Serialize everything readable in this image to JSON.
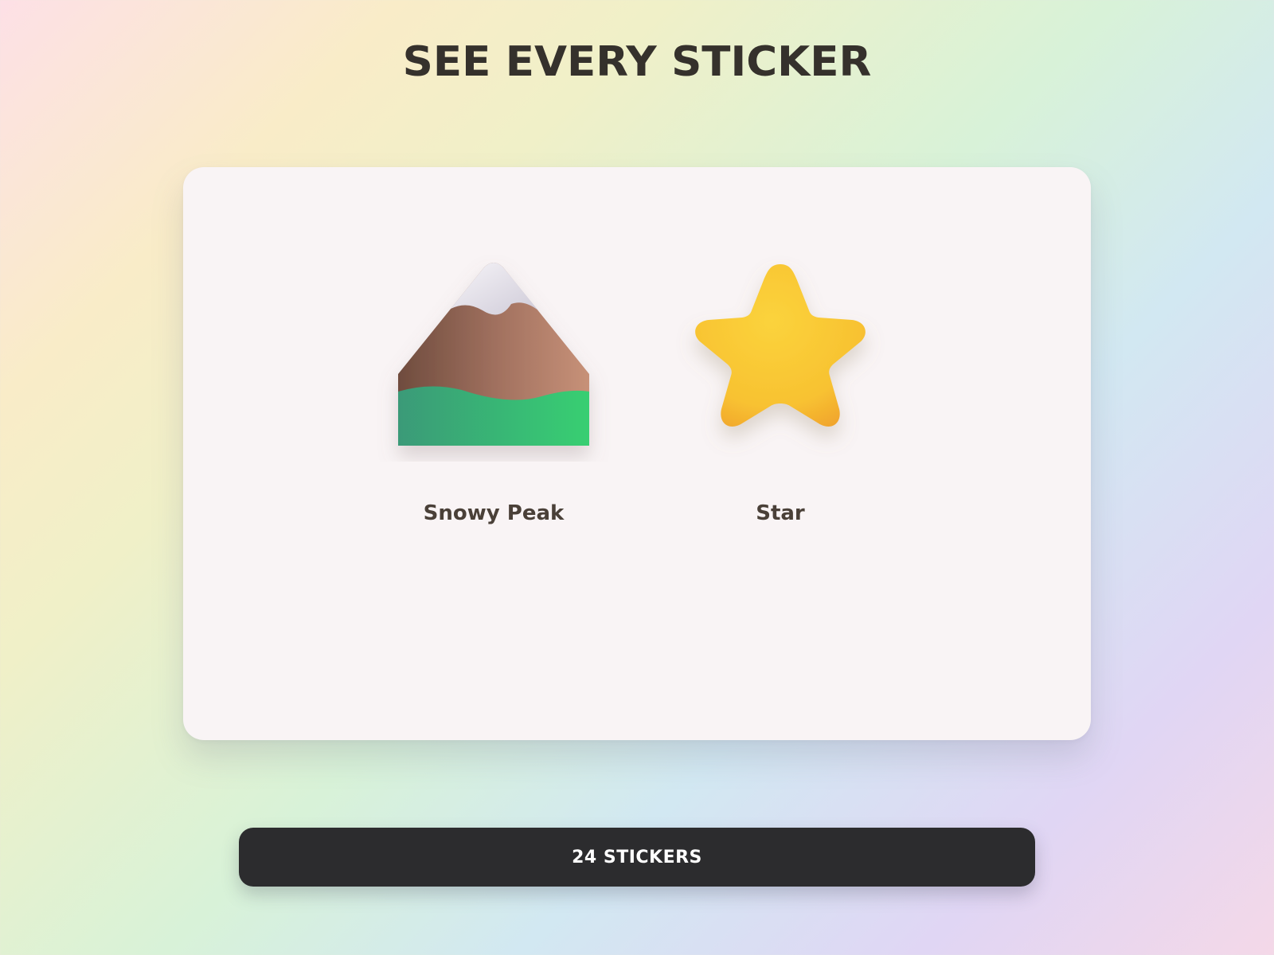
{
  "header": {
    "title": "SEE EVERY STICKER"
  },
  "stickers": [
    {
      "label": "Snowy Peak",
      "icon": "snowy-peak-icon"
    },
    {
      "label": "Star",
      "icon": "star-icon"
    }
  ],
  "footer": {
    "count_label": "24 STICKERS"
  },
  "colors": {
    "title": "#35312c",
    "card": "#f9f4f5",
    "button": "#2c2c2e",
    "star": "#f9c631",
    "grass": "#33c26f",
    "mountain": "#a67563"
  }
}
